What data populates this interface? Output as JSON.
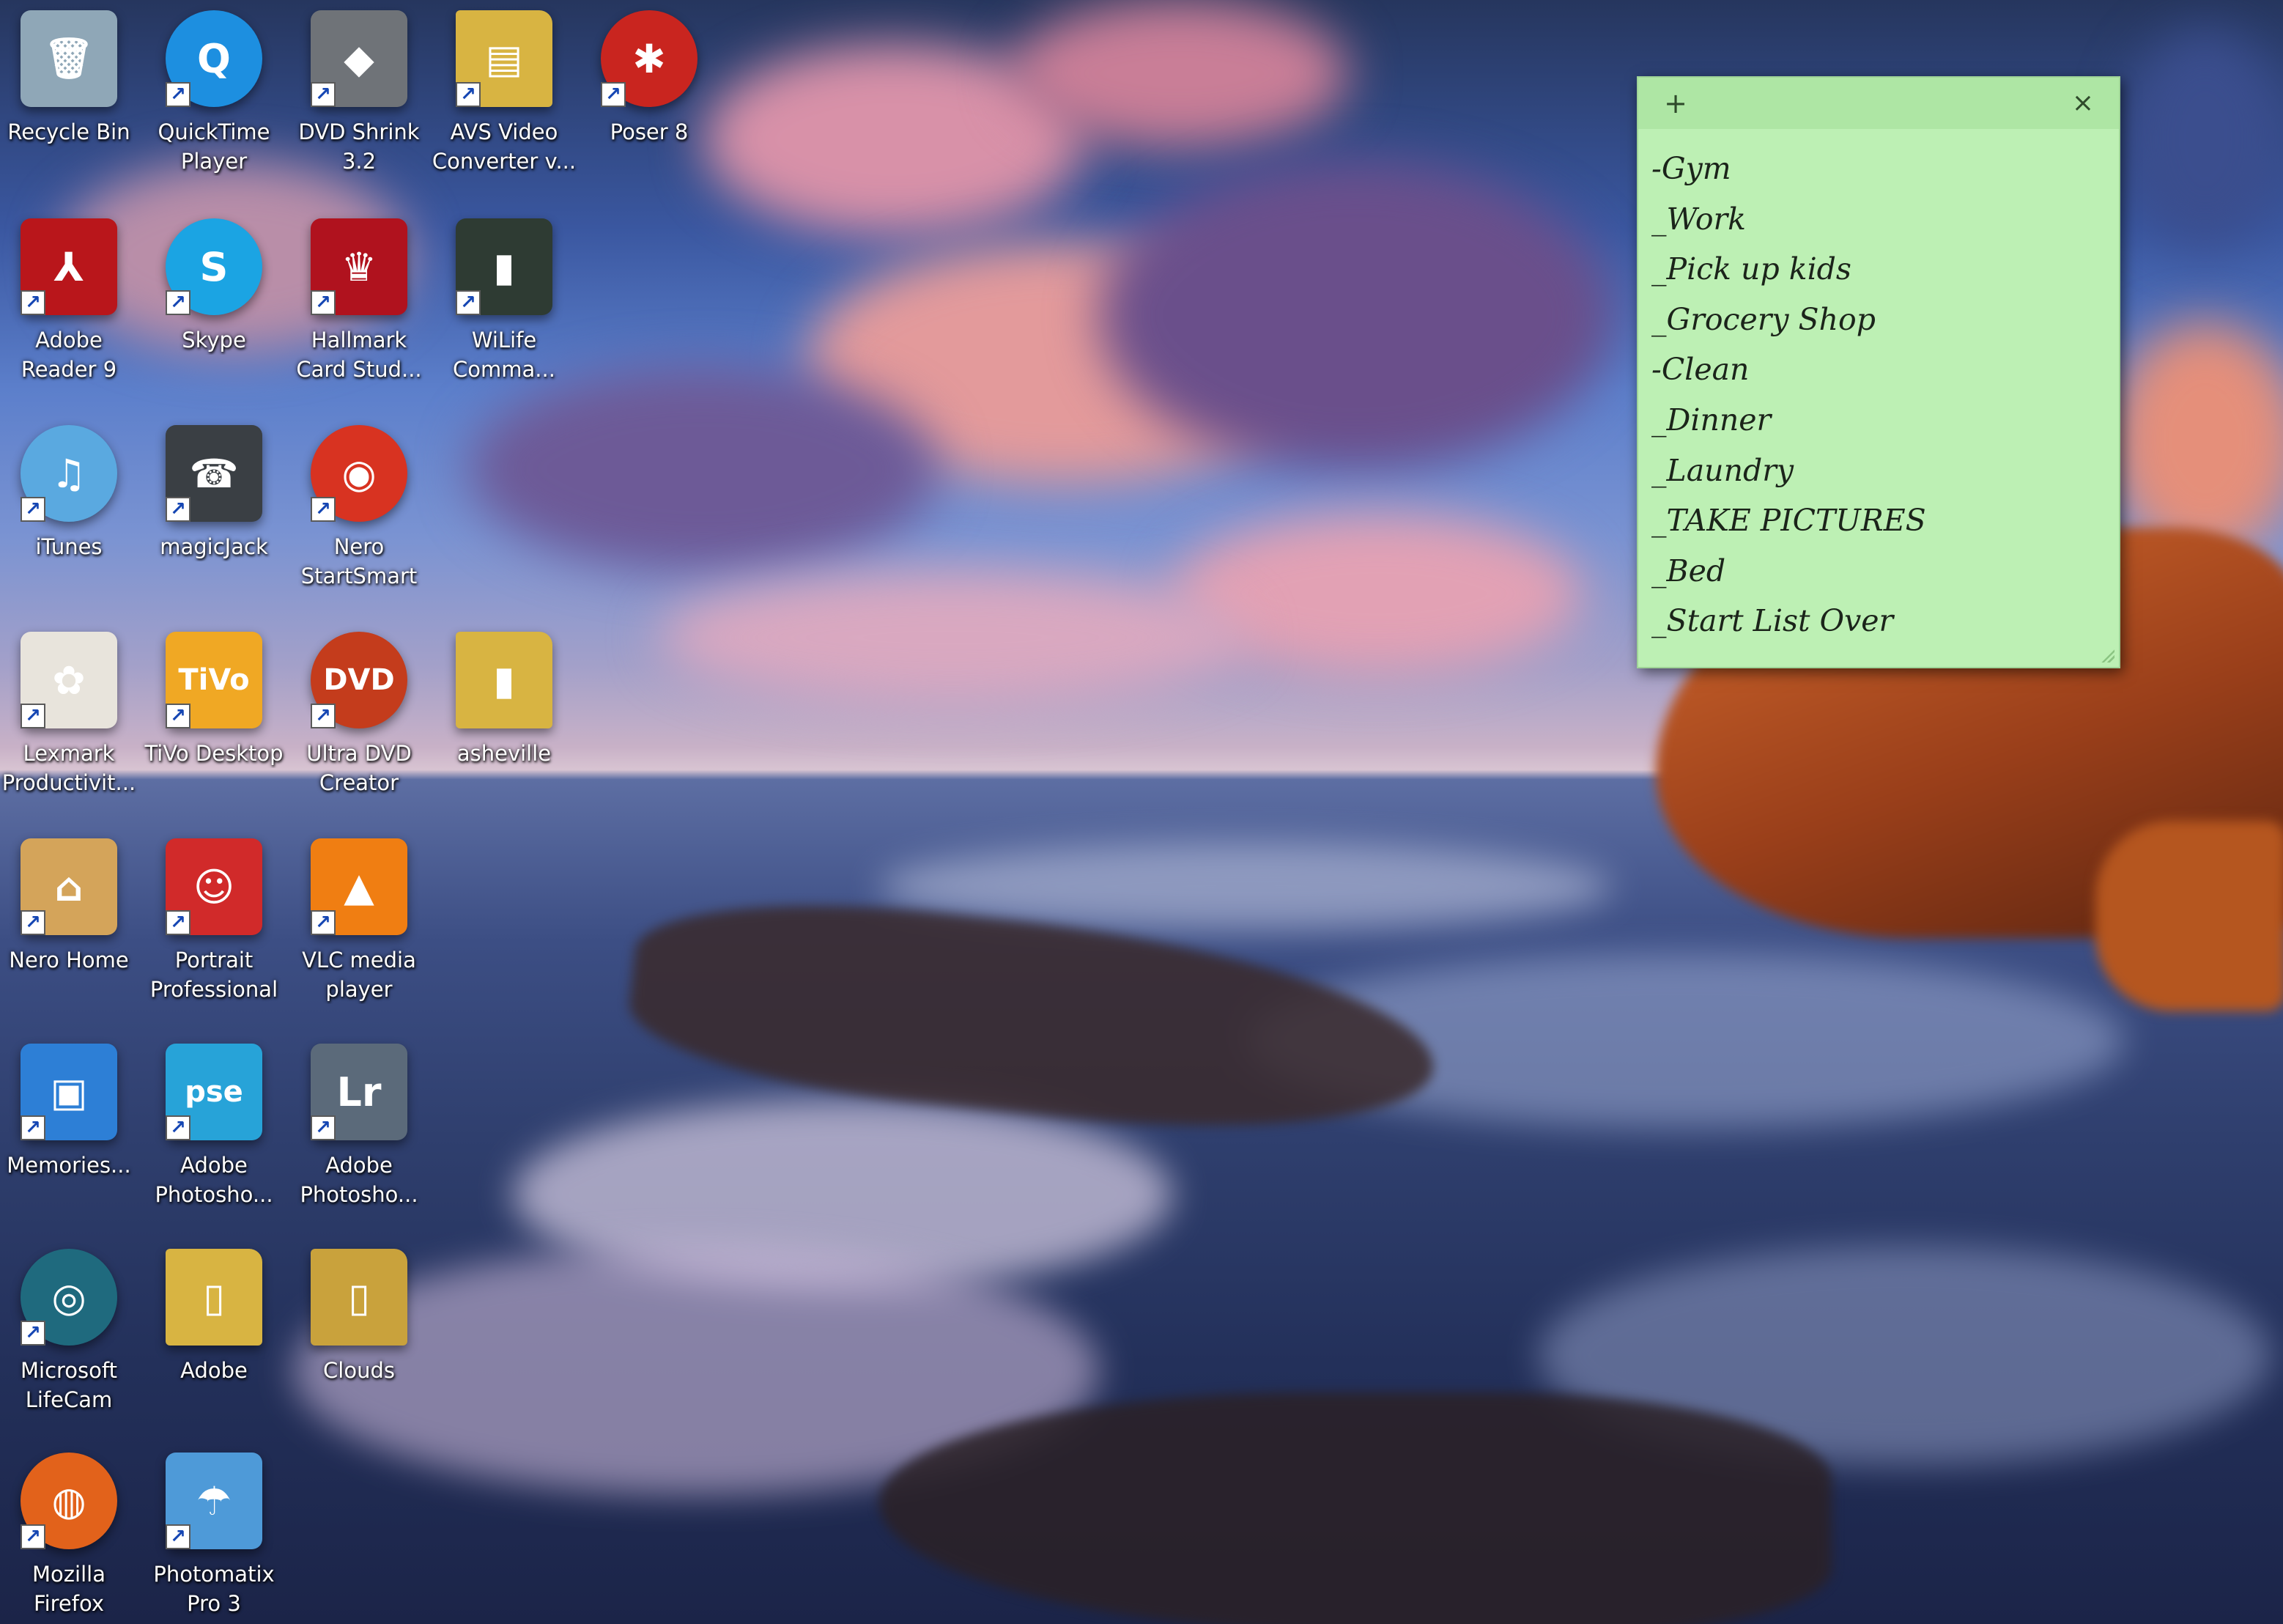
{
  "desktop": {
    "icons": [
      {
        "id": "recycle-bin",
        "label": "Recycle Bin",
        "glyph": "🗑",
        "color": "#8fa7b7",
        "shape": "square",
        "shortcut": false
      },
      {
        "id": "quicktime-player",
        "label": "QuickTime\nPlayer",
        "glyph": "Q",
        "color": "#1d8fe0",
        "shape": "round",
        "shortcut": true
      },
      {
        "id": "dvd-shrink",
        "label": "DVD Shrink\n3.2",
        "glyph": "◆",
        "color": "#6f7378",
        "shape": "square",
        "shortcut": true
      },
      {
        "id": "avs-video-converter",
        "label": "AVS Video\nConverter v...",
        "glyph": "▤",
        "color": "#d8b442",
        "shape": "folder",
        "shortcut": true
      },
      {
        "id": "poser-8",
        "label": "Poser 8",
        "glyph": "✱",
        "color": "#c9251f",
        "shape": "round",
        "shortcut": true
      },
      {
        "id": "adobe-reader-9",
        "label": "Adobe\nReader 9",
        "glyph": "⅄",
        "color": "#b9161b",
        "shape": "square",
        "shortcut": true
      },
      {
        "id": "skype",
        "label": "Skype",
        "glyph": "S",
        "color": "#1ba4e3",
        "shape": "round",
        "shortcut": true
      },
      {
        "id": "hallmark-card-studio",
        "label": "Hallmark\nCard Stud...",
        "glyph": "♛",
        "color": "#b0121e",
        "shape": "square",
        "shortcut": true
      },
      {
        "id": "wilife-command",
        "label": "WiLife\nComma...",
        "glyph": "▮",
        "color": "#2e3b33",
        "shape": "square",
        "shortcut": true
      },
      {
        "id": "itunes",
        "label": "iTunes",
        "glyph": "♫",
        "color": "#5aa9e0",
        "shape": "round",
        "shortcut": true
      },
      {
        "id": "magicjack",
        "label": "magicJack",
        "glyph": "☎",
        "color": "#3a3f44",
        "shape": "square",
        "shortcut": true
      },
      {
        "id": "nero-startsmart",
        "label": "Nero\nStartSmart",
        "glyph": "◉",
        "color": "#d83321",
        "shape": "round",
        "shortcut": true
      },
      {
        "id": "lexmark-productivity",
        "label": "Lexmark\nProductivit...",
        "glyph": "✿",
        "color": "#e8e4dc",
        "shape": "square",
        "shortcut": true
      },
      {
        "id": "tivo-desktop",
        "label": "TiVo Desktop",
        "glyph": "TiVo",
        "color": "#f0a824",
        "shape": "square",
        "shortcut": true
      },
      {
        "id": "ultra-dvd-creator",
        "label": "Ultra DVD\nCreator",
        "glyph": "DVD",
        "color": "#c43c1c",
        "shape": "round",
        "shortcut": true
      },
      {
        "id": "asheville",
        "label": "asheville",
        "glyph": "▮",
        "color": "#d8b442",
        "shape": "folder",
        "shortcut": false
      },
      {
        "id": "nero-home",
        "label": "Nero Home",
        "glyph": "⌂",
        "color": "#d4a45a",
        "shape": "square",
        "shortcut": true
      },
      {
        "id": "portrait-professional",
        "label": "Portrait\nProfessional",
        "glyph": "☺",
        "color": "#d12a2a",
        "shape": "square",
        "shortcut": true
      },
      {
        "id": "vlc-media-player",
        "label": "VLC media\nplayer",
        "glyph": "▲",
        "color": "#f07e12",
        "shape": "square",
        "shortcut": true
      },
      {
        "id": "memories",
        "label": "Memories...",
        "glyph": "▣",
        "color": "#2d7fd6",
        "shape": "square",
        "shortcut": true
      },
      {
        "id": "adobe-photoshop-elements",
        "label": "Adobe\nPhotosho...",
        "glyph": "pse",
        "color": "#27a3d8",
        "shape": "square",
        "shortcut": true
      },
      {
        "id": "adobe-photoshop-lightroom",
        "label": "Adobe\nPhotosho...",
        "glyph": "Lr",
        "color": "#5b6a7a",
        "shape": "square",
        "shortcut": true
      },
      {
        "id": "microsoft-lifecam",
        "label": "Microsoft\nLifeCam",
        "glyph": "◎",
        "color": "#1f6a7e",
        "shape": "round",
        "shortcut": true
      },
      {
        "id": "adobe-folder",
        "label": "Adobe",
        "glyph": "▯",
        "color": "#d8b442",
        "shape": "folder",
        "shortcut": false
      },
      {
        "id": "clouds-folder",
        "label": "Clouds",
        "glyph": "▯",
        "color": "#c9a23c",
        "shape": "folder",
        "shortcut": false
      },
      {
        "id": "mozilla-firefox",
        "label": "Mozilla\nFirefox",
        "glyph": "◍",
        "color": "#e2621b",
        "shape": "round",
        "shortcut": true
      },
      {
        "id": "photomatix-pro-3",
        "label": "Photomatix\nPro 3",
        "glyph": "☂",
        "color": "#4e9ad8",
        "shape": "square",
        "shortcut": true
      }
    ],
    "shortcut_arrow_glyph": "↗"
  },
  "sticky_note": {
    "add_glyph": "+",
    "close_glyph": "×",
    "background_color": "#bdf0b4",
    "lines": [
      "-Gym",
      "_Work",
      "_Pick up kids",
      "_Grocery Shop",
      "-Clean",
      "_Dinner",
      "_Laundry",
      "_TAKE PICTURES",
      "_Bed",
      "_Start List Over"
    ]
  }
}
